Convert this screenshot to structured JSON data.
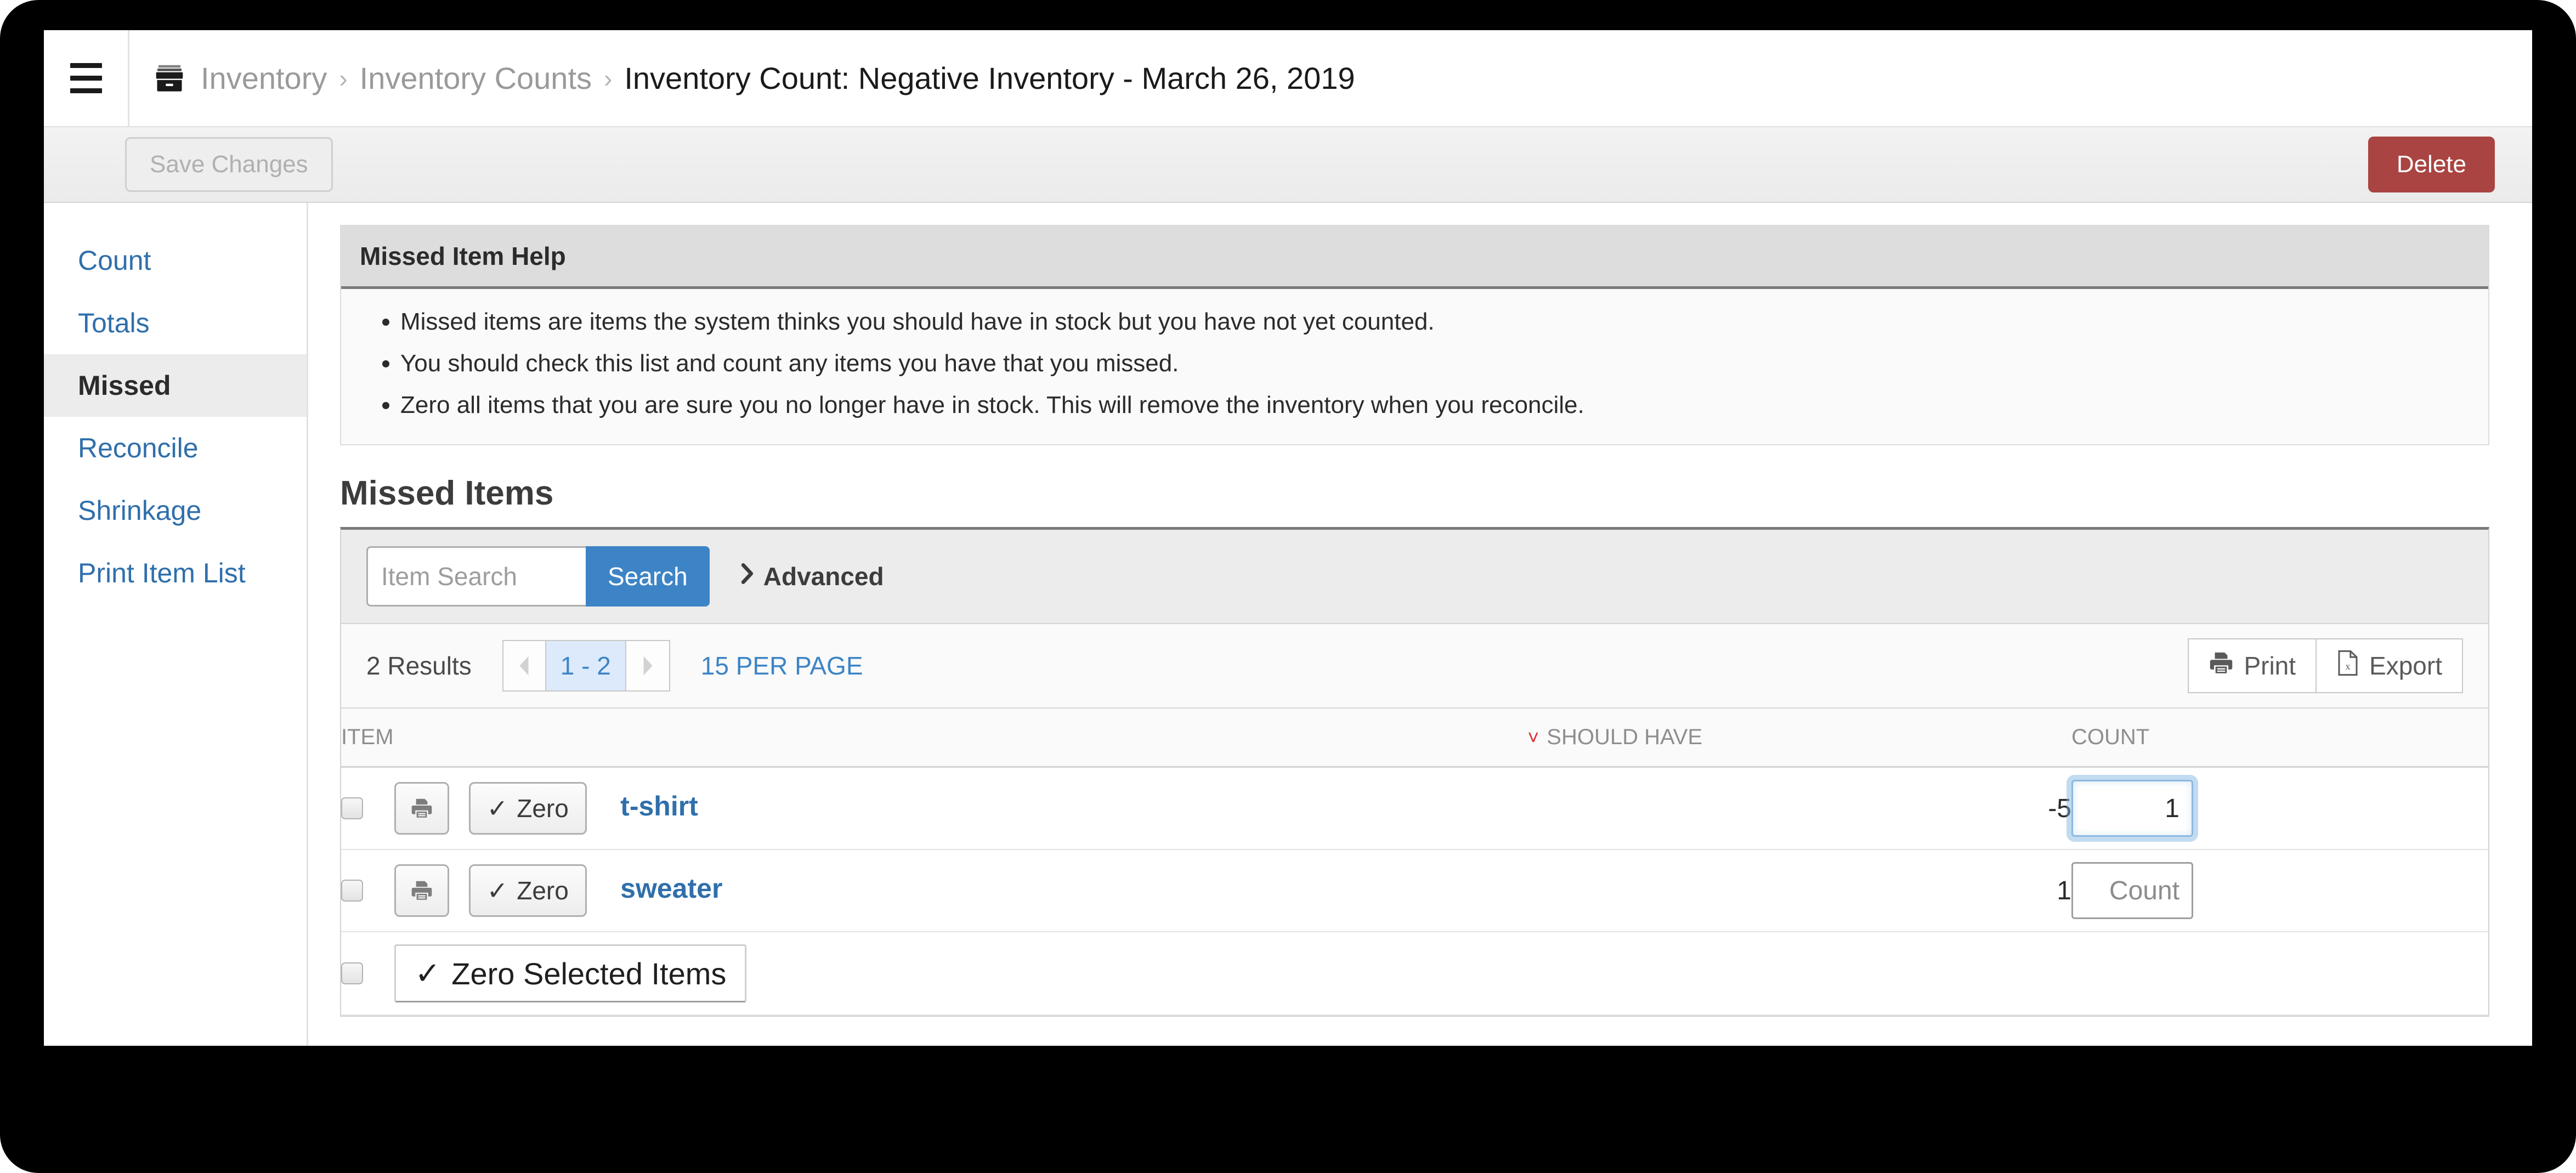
{
  "topbar": {
    "menu_icon": "hamburger-icon",
    "breadcrumb": {
      "icon": "archive-icon",
      "items": [
        {
          "label": "Inventory",
          "current": false
        },
        {
          "label": "Inventory Counts",
          "current": false
        },
        {
          "label": "Inventory Count: Negative Inventory - March 26, 2019",
          "current": true
        }
      ],
      "separator": "›"
    }
  },
  "actionbar": {
    "save_label": "Save Changes",
    "delete_label": "Delete",
    "delete_color": "#a94442"
  },
  "sidebar": {
    "items": [
      {
        "label": "Count",
        "active": false
      },
      {
        "label": "Totals",
        "active": false
      },
      {
        "label": "Missed",
        "active": true
      },
      {
        "label": "Reconcile",
        "active": false
      },
      {
        "label": "Shrinkage",
        "active": false
      },
      {
        "label": "Print Item List",
        "active": false
      }
    ],
    "link_color": "#2f6fab"
  },
  "help": {
    "title": "Missed Item Help",
    "bullets": [
      "Missed items are items the system thinks you should have in stock but you have not yet counted.",
      "You should check this list and count any items you have that you missed.",
      "Zero all items that you are sure you no longer have in stock. This will remove the inventory when you reconcile."
    ]
  },
  "missed": {
    "title": "Missed Items",
    "search": {
      "placeholder": "Item Search",
      "value": "",
      "button_label": "Search",
      "button_color": "#3d84c6",
      "advanced_label": "Advanced",
      "advanced_icon": "chevron-right-icon"
    },
    "pager": {
      "results_label": "2 Results",
      "prev_icon": "caret-left-icon",
      "next_icon": "caret-right-icon",
      "current_range": "1 - 2",
      "per_page_label": "15 PER PAGE"
    },
    "tools": {
      "print_label": "Print",
      "print_icon": "printer-icon",
      "export_label": "Export",
      "export_icon": "file-excel-icon"
    },
    "table": {
      "columns": {
        "item": "ITEM",
        "should_have": "SHOULD HAVE",
        "count": "COUNT"
      },
      "sort": {
        "column": "SHOULD HAVE",
        "direction": "desc",
        "icon": "chevron-down-icon",
        "color": "#e03030"
      },
      "row_actions": {
        "print_icon": "printer-icon",
        "zero_label": "Zero",
        "zero_icon": "check-icon"
      },
      "rows": [
        {
          "selected": false,
          "item": "t-shirt",
          "should_have": "-5",
          "count_value": "1",
          "count_placeholder": "Count",
          "count_focused": true
        },
        {
          "selected": false,
          "item": "sweater",
          "should_have": "1",
          "count_value": "",
          "count_placeholder": "Count",
          "count_focused": false
        }
      ],
      "footer": {
        "selected": false,
        "zero_selected_label": "Zero Selected Items",
        "zero_selected_icon": "check-icon"
      }
    }
  }
}
